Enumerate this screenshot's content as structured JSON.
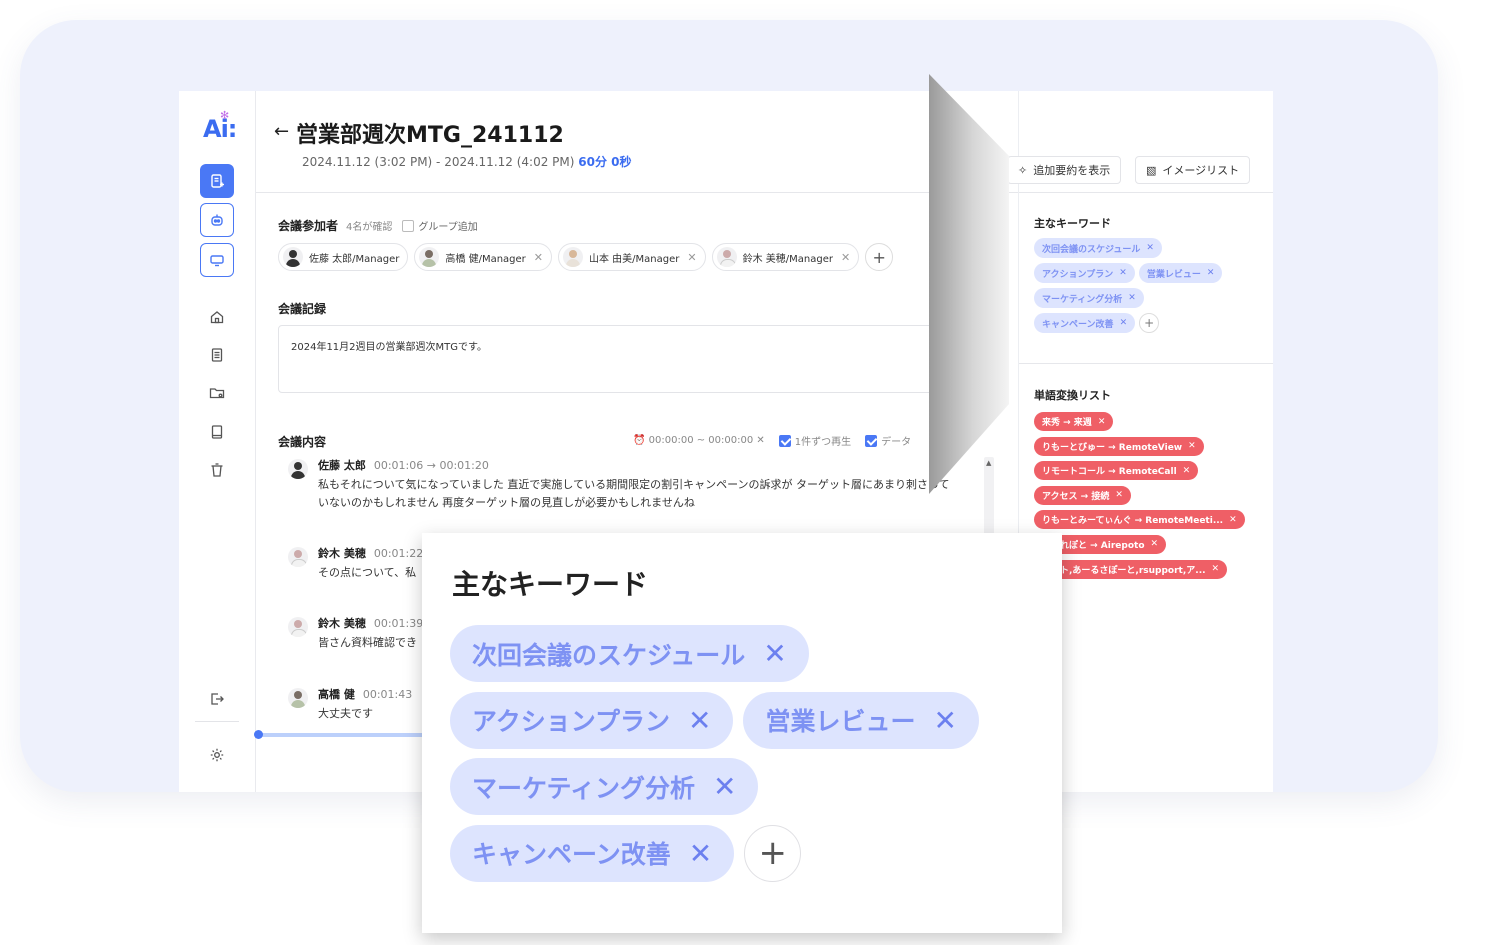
{
  "meeting": {
    "title": "営業部週次MTG_241112",
    "datetime": "2024.11.12 (3:02 PM) - 2024.11.12 (4:02 PM)",
    "duration": "60分 0秒"
  },
  "participants_section": {
    "label": "会議参加者",
    "confirmed": "4名が確認",
    "group_add": "グループ追加",
    "people": [
      {
        "name": "佐藤 太郎/Manager"
      },
      {
        "name": "高橋 健/Manager"
      },
      {
        "name": "山本 由美/Manager"
      },
      {
        "name": "鈴木 美穂/Manager"
      }
    ]
  },
  "record_section": {
    "label": "会議記録",
    "text": "2024年11月2週目の営業部週次MTGです。"
  },
  "content_section": {
    "label": "会議内容",
    "time_range": "00:00:00 ~ 00:00:00",
    "play_each": "1件ずつ再生",
    "data_label": "データ"
  },
  "utterances": [
    {
      "speaker": "佐藤 太郎",
      "time": "00:01:06 → 00:01:20",
      "text": "私もそれについて気になっていました 直近で実施している期間限定の割引キャンペーンの訴求が ターゲット層にあまり刺さっていないのかもしれません 再度ターゲット層の見直しが必要かもしれませんね"
    },
    {
      "speaker": "鈴木 美穂",
      "time": "00:01:22",
      "text": "その点について、私"
    },
    {
      "speaker": "鈴木 美穂",
      "time": "00:01:39",
      "text": "皆さん資料確認でき"
    },
    {
      "speaker": "高橋 健",
      "time": "00:01:43",
      "text": "大丈夫です"
    }
  ],
  "right_panel": {
    "btn_summary": "追加要約を表示",
    "btn_image": "イメージリスト",
    "keywords_label": "主なキーワード",
    "keywords": [
      "次回会議のスケジュール",
      "アクションプラン",
      "営業レビュー",
      "マーケティング分析",
      "キャンペーン改善"
    ],
    "word_list_label": "単語変換リスト",
    "word_conversions": [
      "来秀 → 来週",
      "りもーとびゅー → RemoteView",
      "リモートコール → RemoteCall",
      "アクセス → 接続",
      "りもーとみーてぃんぐ → RemoteMeeti...",
      "あいれぽと → Airepoto",
      "ポート,あーるさぽーと,rsupport,ア..."
    ]
  },
  "zoom_card": {
    "title": "主なキーワード",
    "keywords": [
      "次回会議のスケジュール",
      "アクションプラン",
      "営業レビュー",
      "マーケティング分析",
      "キャンペーン改善"
    ]
  },
  "logo": {
    "text": "Ai:"
  },
  "colors": {
    "accent": "#4a78f5",
    "keyword_bg": "#dde4fe",
    "keyword_text": "#7e92f3",
    "word_bg": "#ef5f66"
  }
}
